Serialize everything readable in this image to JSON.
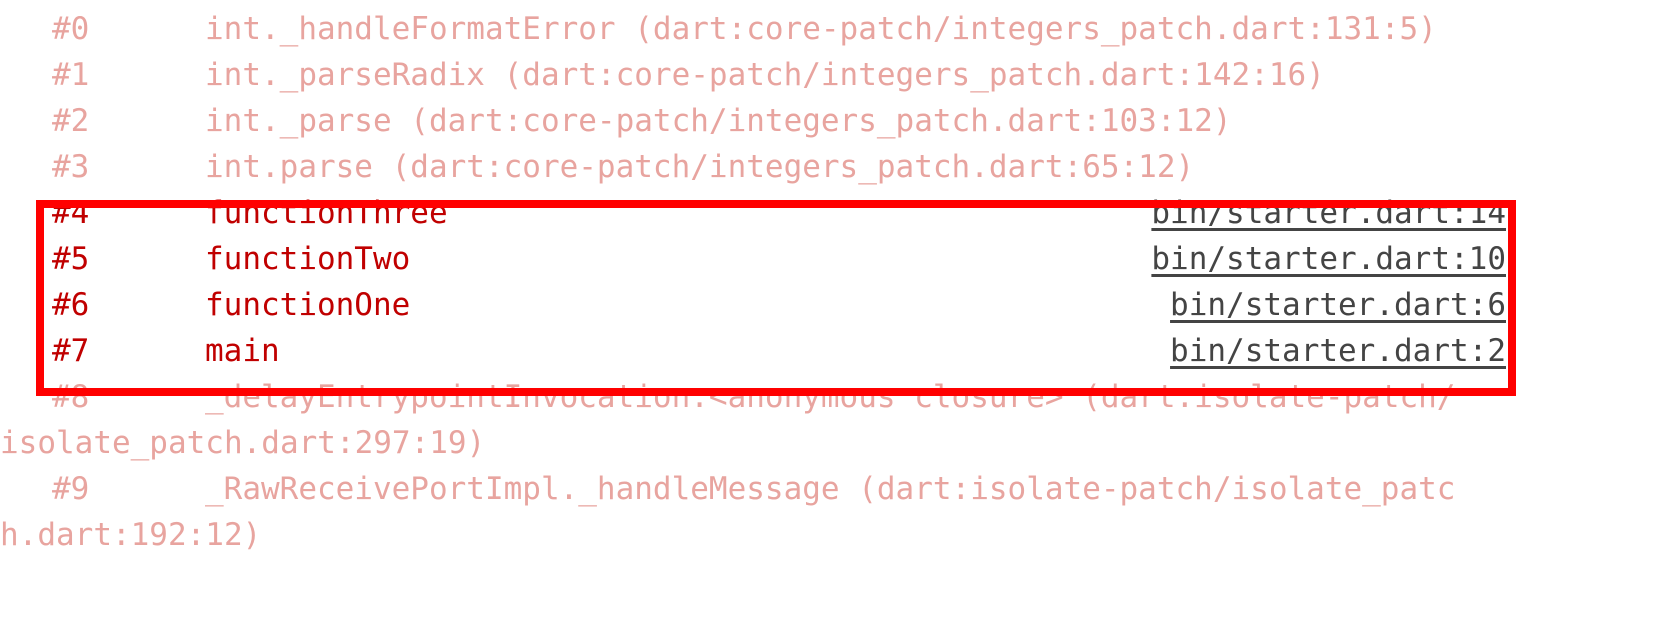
{
  "colors": {
    "faded_text": "#e8a49f",
    "highlight_text": "#c00000",
    "highlight_border": "#ff0000",
    "link_text": "#444444"
  },
  "frames_before": [
    {
      "num": "#0",
      "text": "int._handleFormatError (dart:core-patch/integers_patch.dart:131:5)"
    },
    {
      "num": "#1",
      "text": "int._parseRadix (dart:core-patch/integers_patch.dart:142:16)"
    },
    {
      "num": "#2",
      "text": "int._parse (dart:core-patch/integers_patch.dart:103:12)"
    },
    {
      "num": "#3",
      "text": "int.parse (dart:core-patch/integers_patch.dart:65:12)"
    }
  ],
  "frames_highlighted": [
    {
      "num": "#4",
      "func": "functionThree",
      "location": "bin/starter.dart:14"
    },
    {
      "num": "#5",
      "func": "functionTwo",
      "location": "bin/starter.dart:10"
    },
    {
      "num": "#6",
      "func": "functionOne",
      "location": "bin/starter.dart:6"
    },
    {
      "num": "#7",
      "func": "main",
      "location": "bin/starter.dart:2"
    }
  ],
  "frames_after": [
    {
      "num": "#8",
      "line1": "_delayEntrypointInvocation.<anonymous closure> (dart:isolate-patch/",
      "line2": "isolate_patch.dart:297:19)"
    },
    {
      "num": "#9",
      "line1": "_RawReceivePortImpl._handleMessage (dart:isolate-patch/isolate_patc",
      "line2": "h.dart:192:12)"
    }
  ]
}
